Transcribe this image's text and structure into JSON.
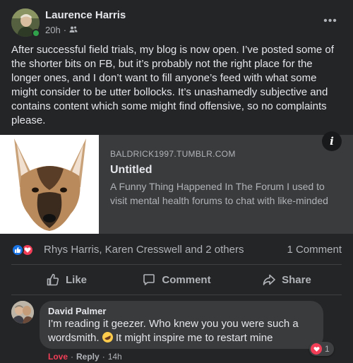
{
  "post": {
    "author": "Laurence Harris",
    "time": "20h",
    "separator": "·",
    "audience_icon": "friends-icon",
    "more_icon": "more-options-icon",
    "more_label": "•••",
    "text": "After successful field trials, my blog is now open. I’ve posted some of the shorter bits on FB, but it’s probably not the right place for the longer ones, and I don’t want to fill anyone’s feed with what some might consider to be utter bollocks. It’s unashamedly subjective and contains content which some might find offensive, so no complaints please."
  },
  "link_preview": {
    "domain": "BALDRICK1997.TUMBLR.COM",
    "title": "Untitled",
    "description": "A Funny Thing Happened In The Forum I used to visit mental health forums to chat with like-minded people. I usually only use them when I’...",
    "info_label": "i",
    "thumbnail": "german-shepherd-dog-image"
  },
  "reactions": {
    "icons": [
      "like-reaction-icon",
      "love-reaction-icon"
    ],
    "summary": "Rhys Harris, Karen Cresswell and 2 others",
    "comments": "1 Comment"
  },
  "actions": {
    "like": "Like",
    "comment": "Comment",
    "share": "Share"
  },
  "comment": {
    "author": "David Palmer",
    "text_before_emoji": "I'm reading it geezer. Who knew you you were such a wordsmith. ",
    "emoji": "rofl-emoji",
    "text_after_emoji": " It might inspire me to restart mine",
    "reaction_count": "1",
    "love_action": "Love",
    "reply_action": "Reply",
    "dot": "·",
    "time": "14h"
  },
  "colors": {
    "background": "#242526",
    "card": "#3a3b3c",
    "primary_text": "#e4e6eb",
    "secondary_text": "#b0b3b8",
    "like_blue": "#1b74e4",
    "love_red": "#f33e58",
    "online_green": "#31a24c"
  }
}
